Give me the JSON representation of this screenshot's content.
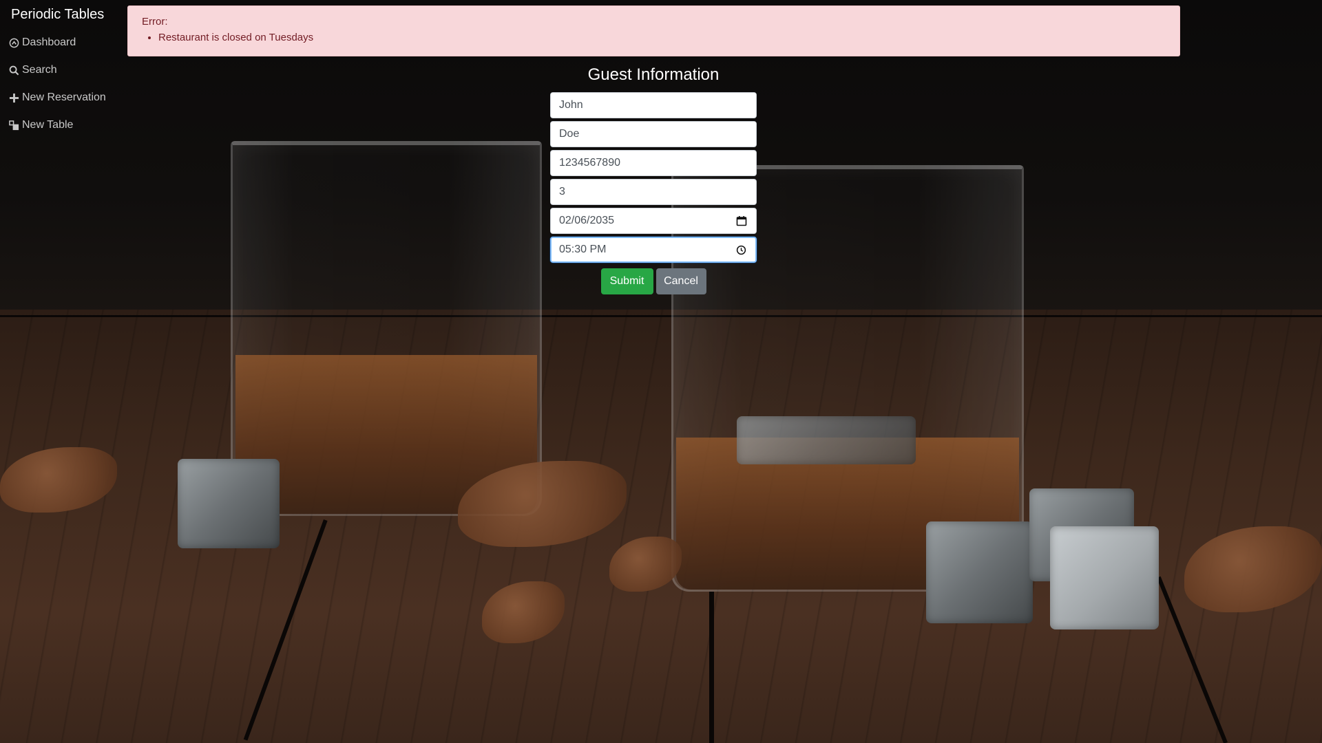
{
  "sidebar": {
    "brand": "Periodic Tables",
    "items": [
      {
        "label": "Dashboard",
        "icon": "dashboard-icon"
      },
      {
        "label": "Search",
        "icon": "search-icon"
      },
      {
        "label": "New Reservation",
        "icon": "plus-icon"
      },
      {
        "label": "New Table",
        "icon": "table-icon"
      }
    ]
  },
  "alert": {
    "title": "Error:",
    "messages": [
      "Restaurant is closed on Tuesdays"
    ],
    "colors": {
      "background": "#f8d7da",
      "text": "#721c24"
    }
  },
  "form": {
    "title": "Guest Information",
    "fields": {
      "first_name": "John",
      "last_name": "Doe",
      "mobile_number": "1234567890",
      "people": "3",
      "reservation_date": "02/06/2035",
      "reservation_time": "05:30 PM"
    },
    "submit_label": "Submit",
    "cancel_label": "Cancel",
    "colors": {
      "submit": "#28a745",
      "cancel": "#6c757d"
    }
  }
}
